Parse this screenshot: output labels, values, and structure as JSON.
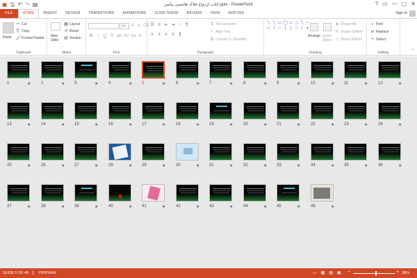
{
  "window": {
    "title": "کتاب ازدواج فلاک هاشمی پیامبر.pptx - PowerPoint",
    "controls": [
      "?",
      "▭",
      "—",
      "▢",
      "✕"
    ]
  },
  "quick_access": {
    "icons": [
      "powerpoint-logo-icon",
      "save-icon",
      "undo-icon",
      "redo-icon",
      "start-from-beginning-icon"
    ]
  },
  "tabs": [
    {
      "label": "FILE"
    },
    {
      "label": "HOME"
    },
    {
      "label": "INSERT"
    },
    {
      "label": "DESIGN"
    },
    {
      "label": "TRANSITIONS"
    },
    {
      "label": "ANIMATIONS"
    },
    {
      "label": "SLIDE SHOW"
    },
    {
      "label": "REVIEW"
    },
    {
      "label": "VIEW"
    },
    {
      "label": "ADD-INS"
    }
  ],
  "account": {
    "signin": "Sign in"
  },
  "ribbon": {
    "clipboard": {
      "label": "Clipboard",
      "paste": "Paste",
      "cut": "Cut",
      "copy": "Copy",
      "format_painter": "Format Painter"
    },
    "slides": {
      "label": "Slides",
      "new_slide": "New",
      "new_slide_2": "Slide",
      "layout": "Layout",
      "reset": "Reset",
      "section": "Section"
    },
    "font": {
      "label": "Font",
      "size": "44"
    },
    "paragraph": {
      "label": "Paragraph",
      "text_direction": "Text Direction",
      "align_text": "Align Text",
      "smartart": "Convert to SmartArt"
    },
    "drawing": {
      "label": "Drawing",
      "arrange": "Arrange",
      "quick_styles": "Quick",
      "quick_styles_2": "Styles",
      "shape_fill": "Shape Fill",
      "shape_outline": "Shape Outline",
      "shape_effects": "Shape Effects"
    },
    "editing": {
      "label": "Editing",
      "find": "Find",
      "replace": "Replace",
      "select": "Select"
    }
  },
  "slides": [
    {
      "num": "1",
      "kind": "dark"
    },
    {
      "num": "2",
      "kind": "dark"
    },
    {
      "num": "3",
      "kind": "title"
    },
    {
      "num": "4",
      "kind": "dark"
    },
    {
      "num": "5",
      "kind": "dark"
    },
    {
      "num": "6",
      "kind": "dark"
    },
    {
      "num": "7",
      "kind": "dark"
    },
    {
      "num": "8",
      "kind": "dark"
    },
    {
      "num": "9",
      "kind": "dark"
    },
    {
      "num": "10",
      "kind": "dark"
    },
    {
      "num": "11",
      "kind": "dark"
    },
    {
      "num": "12",
      "kind": "dark"
    },
    {
      "num": "13",
      "kind": "dark"
    },
    {
      "num": "14",
      "kind": "dark"
    },
    {
      "num": "15",
      "kind": "dark"
    },
    {
      "num": "16",
      "kind": "dark"
    },
    {
      "num": "17",
      "kind": "dark"
    },
    {
      "num": "18",
      "kind": "dark"
    },
    {
      "num": "19",
      "kind": "title"
    },
    {
      "num": "20",
      "kind": "dark"
    },
    {
      "num": "21",
      "kind": "dark"
    },
    {
      "num": "22",
      "kind": "dark"
    },
    {
      "num": "23",
      "kind": "dark"
    },
    {
      "num": "24",
      "kind": "dark"
    },
    {
      "num": "25",
      "kind": "dark"
    },
    {
      "num": "26",
      "kind": "dark"
    },
    {
      "num": "27",
      "kind": "dark"
    },
    {
      "num": "28",
      "kind": "photo-blue"
    },
    {
      "num": "29",
      "kind": "dark"
    },
    {
      "num": "30",
      "kind": "photo-sky"
    },
    {
      "num": "31",
      "kind": "dark"
    },
    {
      "num": "32",
      "kind": "dark"
    },
    {
      "num": "33",
      "kind": "dark"
    },
    {
      "num": "34",
      "kind": "dark"
    },
    {
      "num": "35",
      "kind": "dark"
    },
    {
      "num": "36",
      "kind": "dark"
    },
    {
      "num": "37",
      "kind": "dark"
    },
    {
      "num": "38",
      "kind": "dark"
    },
    {
      "num": "39",
      "kind": "title"
    },
    {
      "num": "40",
      "kind": "red"
    },
    {
      "num": "41",
      "kind": "photo-pink"
    },
    {
      "num": "42",
      "kind": "dark"
    },
    {
      "num": "43",
      "kind": "dark"
    },
    {
      "num": "44",
      "kind": "dark"
    },
    {
      "num": "45",
      "kind": "title"
    },
    {
      "num": "46",
      "kind": "photo-gray"
    }
  ],
  "selected_slide": "5",
  "status": {
    "slide_info": "SLIDE 5 OF 46",
    "language": "PERSIAN",
    "zoom_minus": "−",
    "zoom_plus": "+",
    "zoom": "38%"
  },
  "colors": {
    "accent": "#d24726",
    "sorter_bg": "#e8e8e8",
    "slide_bg": "#050805"
  }
}
